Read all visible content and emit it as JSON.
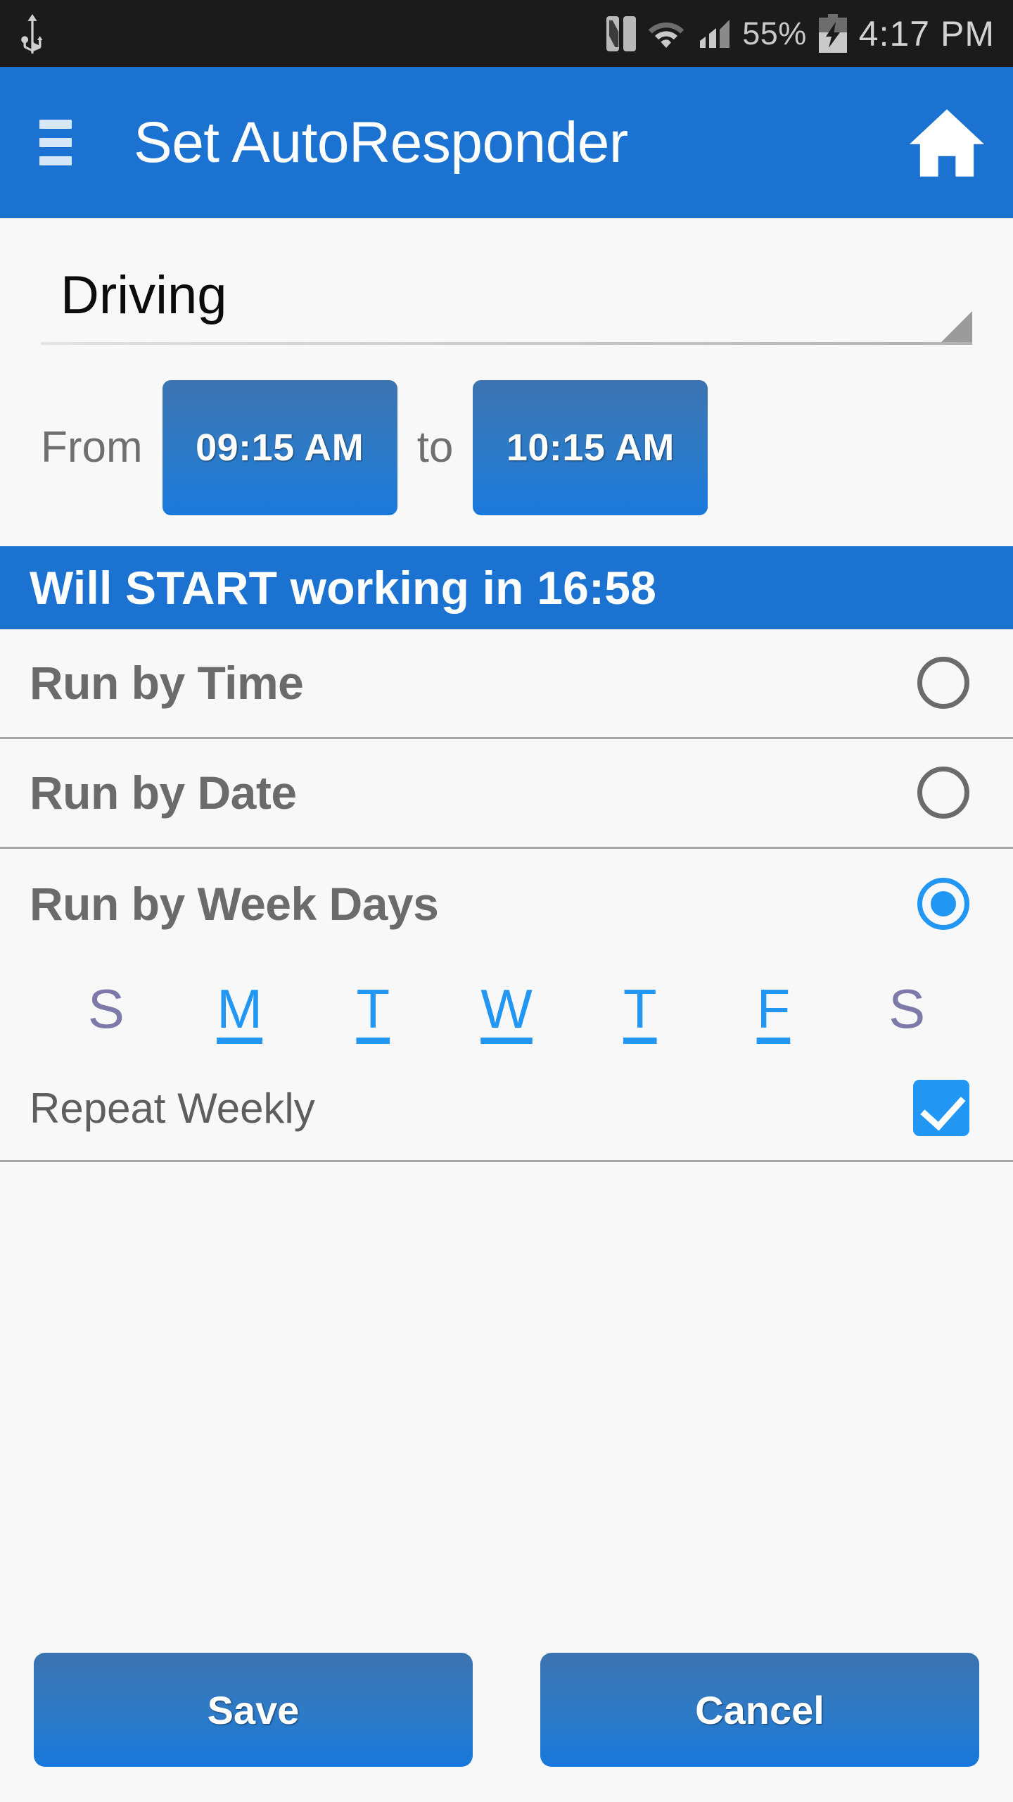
{
  "status_bar": {
    "usb_icon": "usb-icon",
    "nfc_icon": "nfc-icon",
    "wifi_icon": "wifi-icon",
    "signal_icon": "signal-bars-icon",
    "battery_percent": "55%",
    "battery_icon": "battery-charging-icon",
    "time": "4:17 PM"
  },
  "app_bar": {
    "menu_icon": "hamburger-menu-icon",
    "title": "Set AutoResponder",
    "home_icon": "home-icon"
  },
  "profile_spinner": {
    "selected": "Driving",
    "dropdown_icon": "dropdown-triangle-icon"
  },
  "schedule": {
    "from_label": "From",
    "from_time": "09:15 AM",
    "to_label": "to",
    "to_time": "10:15 AM"
  },
  "banner": {
    "text": "Will START working in 16:58"
  },
  "run_modes": [
    {
      "label": "Run by Time",
      "selected": false
    },
    {
      "label": "Run by Date",
      "selected": false
    },
    {
      "label": "Run by Week Days",
      "selected": true
    }
  ],
  "week_days": [
    {
      "letter": "S",
      "selected": false
    },
    {
      "letter": "M",
      "selected": true
    },
    {
      "letter": "T",
      "selected": true
    },
    {
      "letter": "W",
      "selected": true
    },
    {
      "letter": "T",
      "selected": true
    },
    {
      "letter": "F",
      "selected": true
    },
    {
      "letter": "S",
      "selected": false
    }
  ],
  "repeat": {
    "label": "Repeat Weekly",
    "checked": true
  },
  "footer": {
    "save_label": "Save",
    "cancel_label": "Cancel"
  },
  "colors": {
    "accent_blue": "#1b72d0",
    "radio_blue": "#2196f3",
    "day_off": "#7d79a8",
    "status_bar_bg": "#1b1b1b",
    "page_bg": "#f8f8f8"
  }
}
